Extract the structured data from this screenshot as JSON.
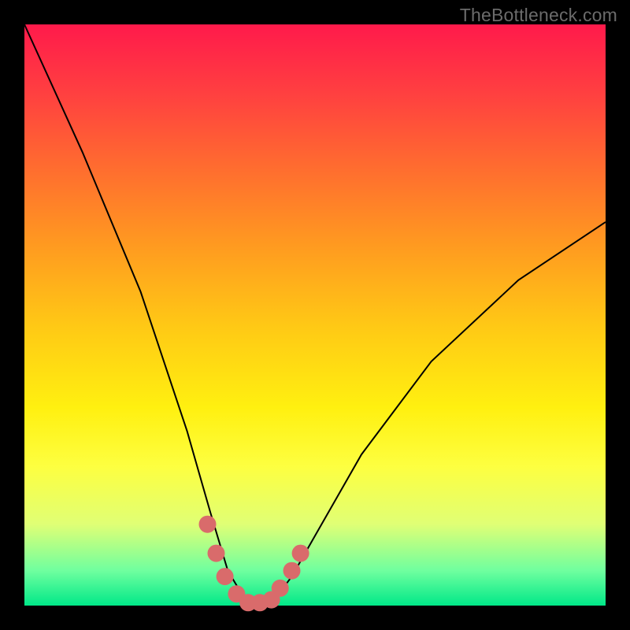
{
  "watermark": "TheBottleneck.com",
  "chart_data": {
    "type": "line",
    "title": "",
    "xlabel": "",
    "ylabel": "",
    "xlim": [
      0,
      100
    ],
    "ylim": [
      0,
      100
    ],
    "series": [
      {
        "name": "bottleneck-curve",
        "x": [
          0,
          10,
          20,
          28,
          32,
          35,
          38,
          40,
          43,
          46,
          50,
          58,
          70,
          85,
          100
        ],
        "y": [
          100,
          78,
          54,
          30,
          16,
          6,
          1,
          0,
          1,
          5,
          12,
          26,
          42,
          56,
          66
        ]
      }
    ],
    "highlight_zone": {
      "name": "optimal-range-markers",
      "points": [
        {
          "x": 31.5,
          "y": 14
        },
        {
          "x": 33.0,
          "y": 9
        },
        {
          "x": 34.5,
          "y": 5
        },
        {
          "x": 36.5,
          "y": 2
        },
        {
          "x": 38.5,
          "y": 0.5
        },
        {
          "x": 40.5,
          "y": 0.5
        },
        {
          "x": 42.5,
          "y": 1
        },
        {
          "x": 44.0,
          "y": 3
        },
        {
          "x": 46.0,
          "y": 6
        },
        {
          "x": 47.5,
          "y": 9
        }
      ]
    },
    "gradient_stops": [
      {
        "pos": 0,
        "color": "#ff1a4b"
      },
      {
        "pos": 12,
        "color": "#ff4040"
      },
      {
        "pos": 24,
        "color": "#ff6a30"
      },
      {
        "pos": 38,
        "color": "#ff9a20"
      },
      {
        "pos": 52,
        "color": "#ffc915"
      },
      {
        "pos": 66,
        "color": "#fff010"
      },
      {
        "pos": 76,
        "color": "#fdff40"
      },
      {
        "pos": 86,
        "color": "#e0ff75"
      },
      {
        "pos": 94,
        "color": "#6fff9f"
      },
      {
        "pos": 100,
        "color": "#00e888"
      }
    ],
    "colors": {
      "curve": "#000000",
      "marker": "#d96b6b",
      "frame": "#000000"
    }
  }
}
